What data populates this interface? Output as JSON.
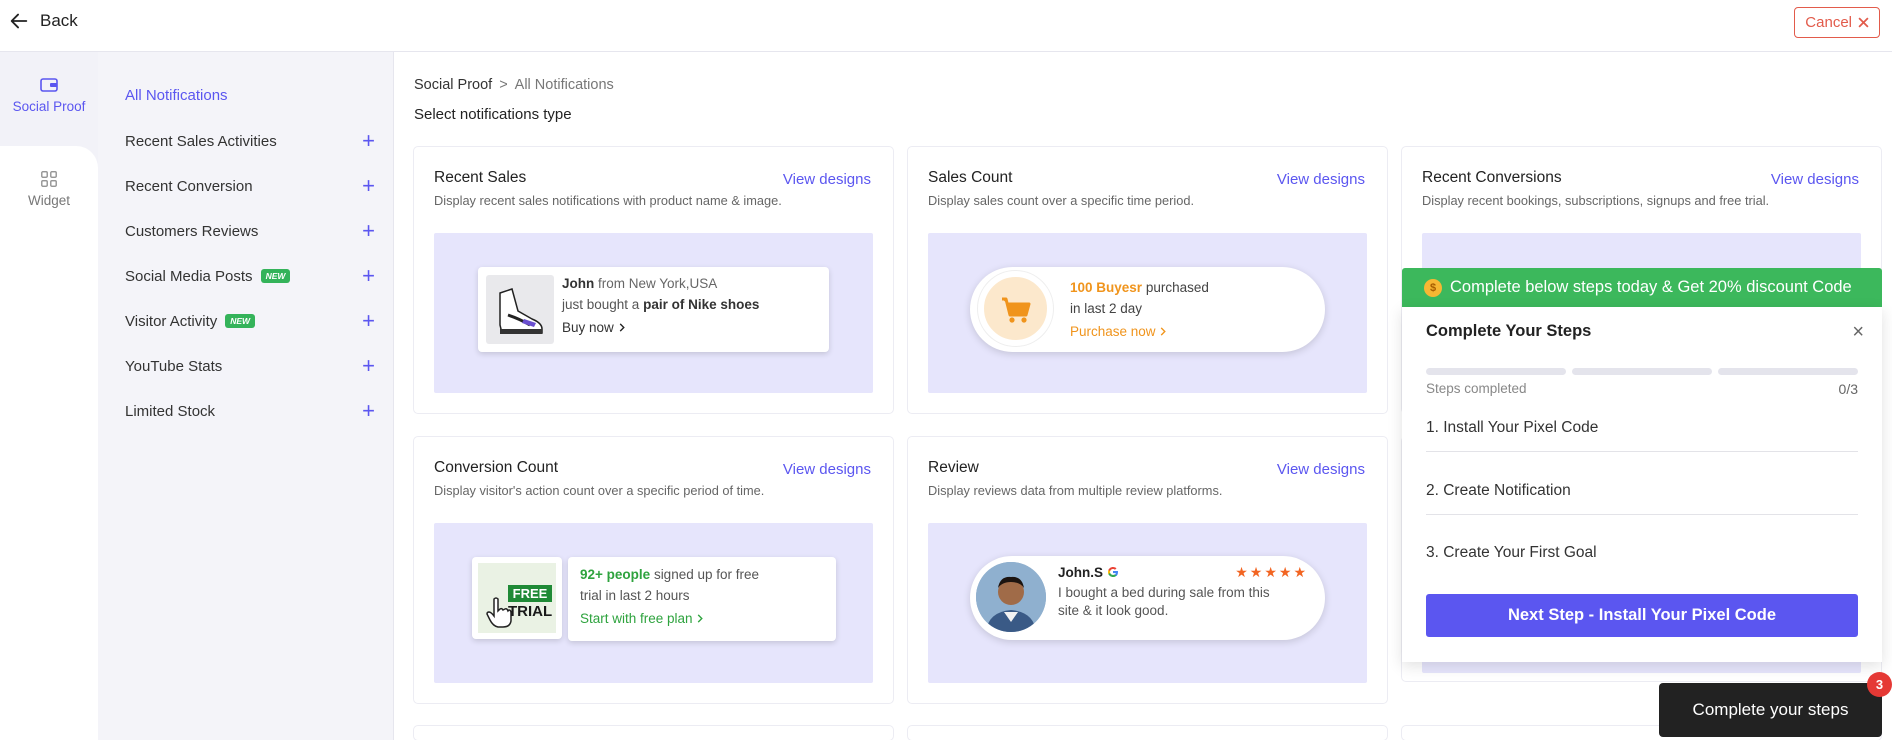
{
  "topbar": {
    "back_label": "Back",
    "cancel_label": "Cancel"
  },
  "rail": {
    "social_proof_label": "Social Proof",
    "widget_label": "Widget"
  },
  "sidebar": {
    "all_label": "All Notifications",
    "items": [
      {
        "label": "Recent Sales Activities",
        "badge": ""
      },
      {
        "label": "Recent Conversion",
        "badge": ""
      },
      {
        "label": "Customers Reviews",
        "badge": ""
      },
      {
        "label": "Social Media Posts",
        "badge": "NEW"
      },
      {
        "label": "Visitor Activity",
        "badge": "NEW"
      },
      {
        "label": "YouTube Stats",
        "badge": ""
      },
      {
        "label": "Limited Stock",
        "badge": ""
      }
    ],
    "plus_symbol": "+"
  },
  "breadcrumb": {
    "root": "Social Proof",
    "sep": ">",
    "current": "All Notifications"
  },
  "main": {
    "subtitle": "Select notifications type",
    "view_designs": "View designs"
  },
  "cards": {
    "recent_sales": {
      "title": "Recent Sales",
      "desc": "Display recent sales notifications with product name & image.",
      "name": "John",
      "from": "from New York,USA",
      "line2_pre": "just bought a",
      "product": "pair of Nike shoes",
      "cta": "Buy now"
    },
    "sales_count": {
      "title": "Sales Count",
      "desc": "Display sales count over a specific time period.",
      "count": "100 Buyesr",
      "line1_post": "purchased",
      "line2": "in last 2 day",
      "cta": "Purchase now"
    },
    "recent_conversions": {
      "title": "Recent Conversions",
      "desc": "Display recent bookings, subscriptions, signups and free trial."
    },
    "conversion_count": {
      "title": "Conversion Count",
      "desc": "Display visitor's action count over a specific period of time.",
      "img_line1": "FREE",
      "img_line2": "TRIAL",
      "count": "92+ people",
      "line1_post": "signed up for free",
      "line2": "trial in last 2 hours",
      "cta": "Start with free plan"
    },
    "review": {
      "title": "Review",
      "desc": "Display reviews data from multiple review platforms.",
      "name": "John.S",
      "stars": "★★★★★",
      "line1": "I bought a bed during sale from this",
      "line2": "site & it look good."
    }
  },
  "steps_panel": {
    "promo": "Complete below steps today & Get 20% discount Code",
    "coin_symbol": "$",
    "title": "Complete Your Steps",
    "close": "×",
    "completed_label": "Steps completed",
    "completed_count": "0/3",
    "steps": [
      "1. Install Your Pixel Code",
      "2. Create Notification",
      "3. Create Your First Goal"
    ],
    "next_button": "Next Step - Install Your Pixel Code"
  },
  "complete_button": {
    "label": "Complete your steps",
    "badge": "3"
  },
  "colors": {
    "accent": "#5b56f0",
    "promo_green": "#3cb85c",
    "cancel_red": "#e25b4b",
    "preview_bg": "#e6e5fc",
    "orange": "#f0941c"
  }
}
